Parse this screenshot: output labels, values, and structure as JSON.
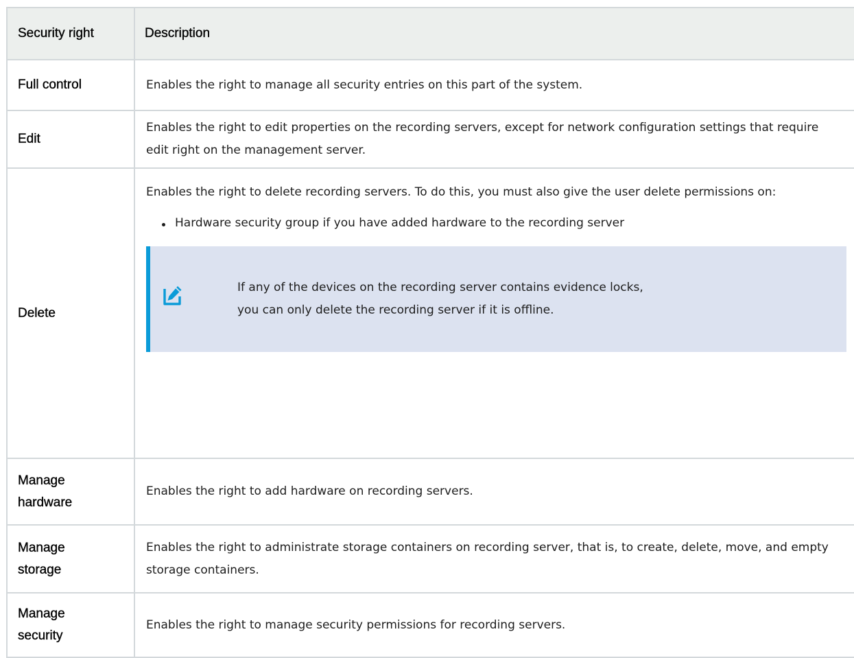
{
  "table": {
    "headers": {
      "right": "Security right",
      "description": "Description"
    },
    "rows": [
      {
        "right": "Full control",
        "description": "Enables the right to manage all security entries on this part of the system."
      },
      {
        "right": "Edit",
        "description": "Enables the right to edit properties on the recording servers, except for network configuration settings that require edit right on the management server."
      },
      {
        "right": "Delete",
        "description": "Enables the right to delete recording servers. To do this, you must also give the user delete permissions on:",
        "bullet": "Hardware security group if you have added hardware to the recording server",
        "note": {
          "icon": "pencil-icon",
          "line1": "If any of the devices on the recording server contains evidence locks,",
          "line2": "you can only delete the recording server if it is offline."
        }
      },
      {
        "right_line1": "Manage",
        "right_line2": "hardware",
        "description": "Enables the right to add hardware on recording servers."
      },
      {
        "right_line1": "Manage",
        "right_line2": "storage",
        "description": "Enables the right to administrate storage containers on recording server, that is, to create, delete, move, and empty storage containers."
      },
      {
        "right_line1": "Manage",
        "right_line2": "security",
        "description": "Enables the right to manage security permissions for recording servers."
      }
    ]
  },
  "colors": {
    "header_bg": "#ecefed",
    "border": "#d3d8db",
    "note_bg": "#dce2f0",
    "note_accent": "#0a9bd8"
  }
}
